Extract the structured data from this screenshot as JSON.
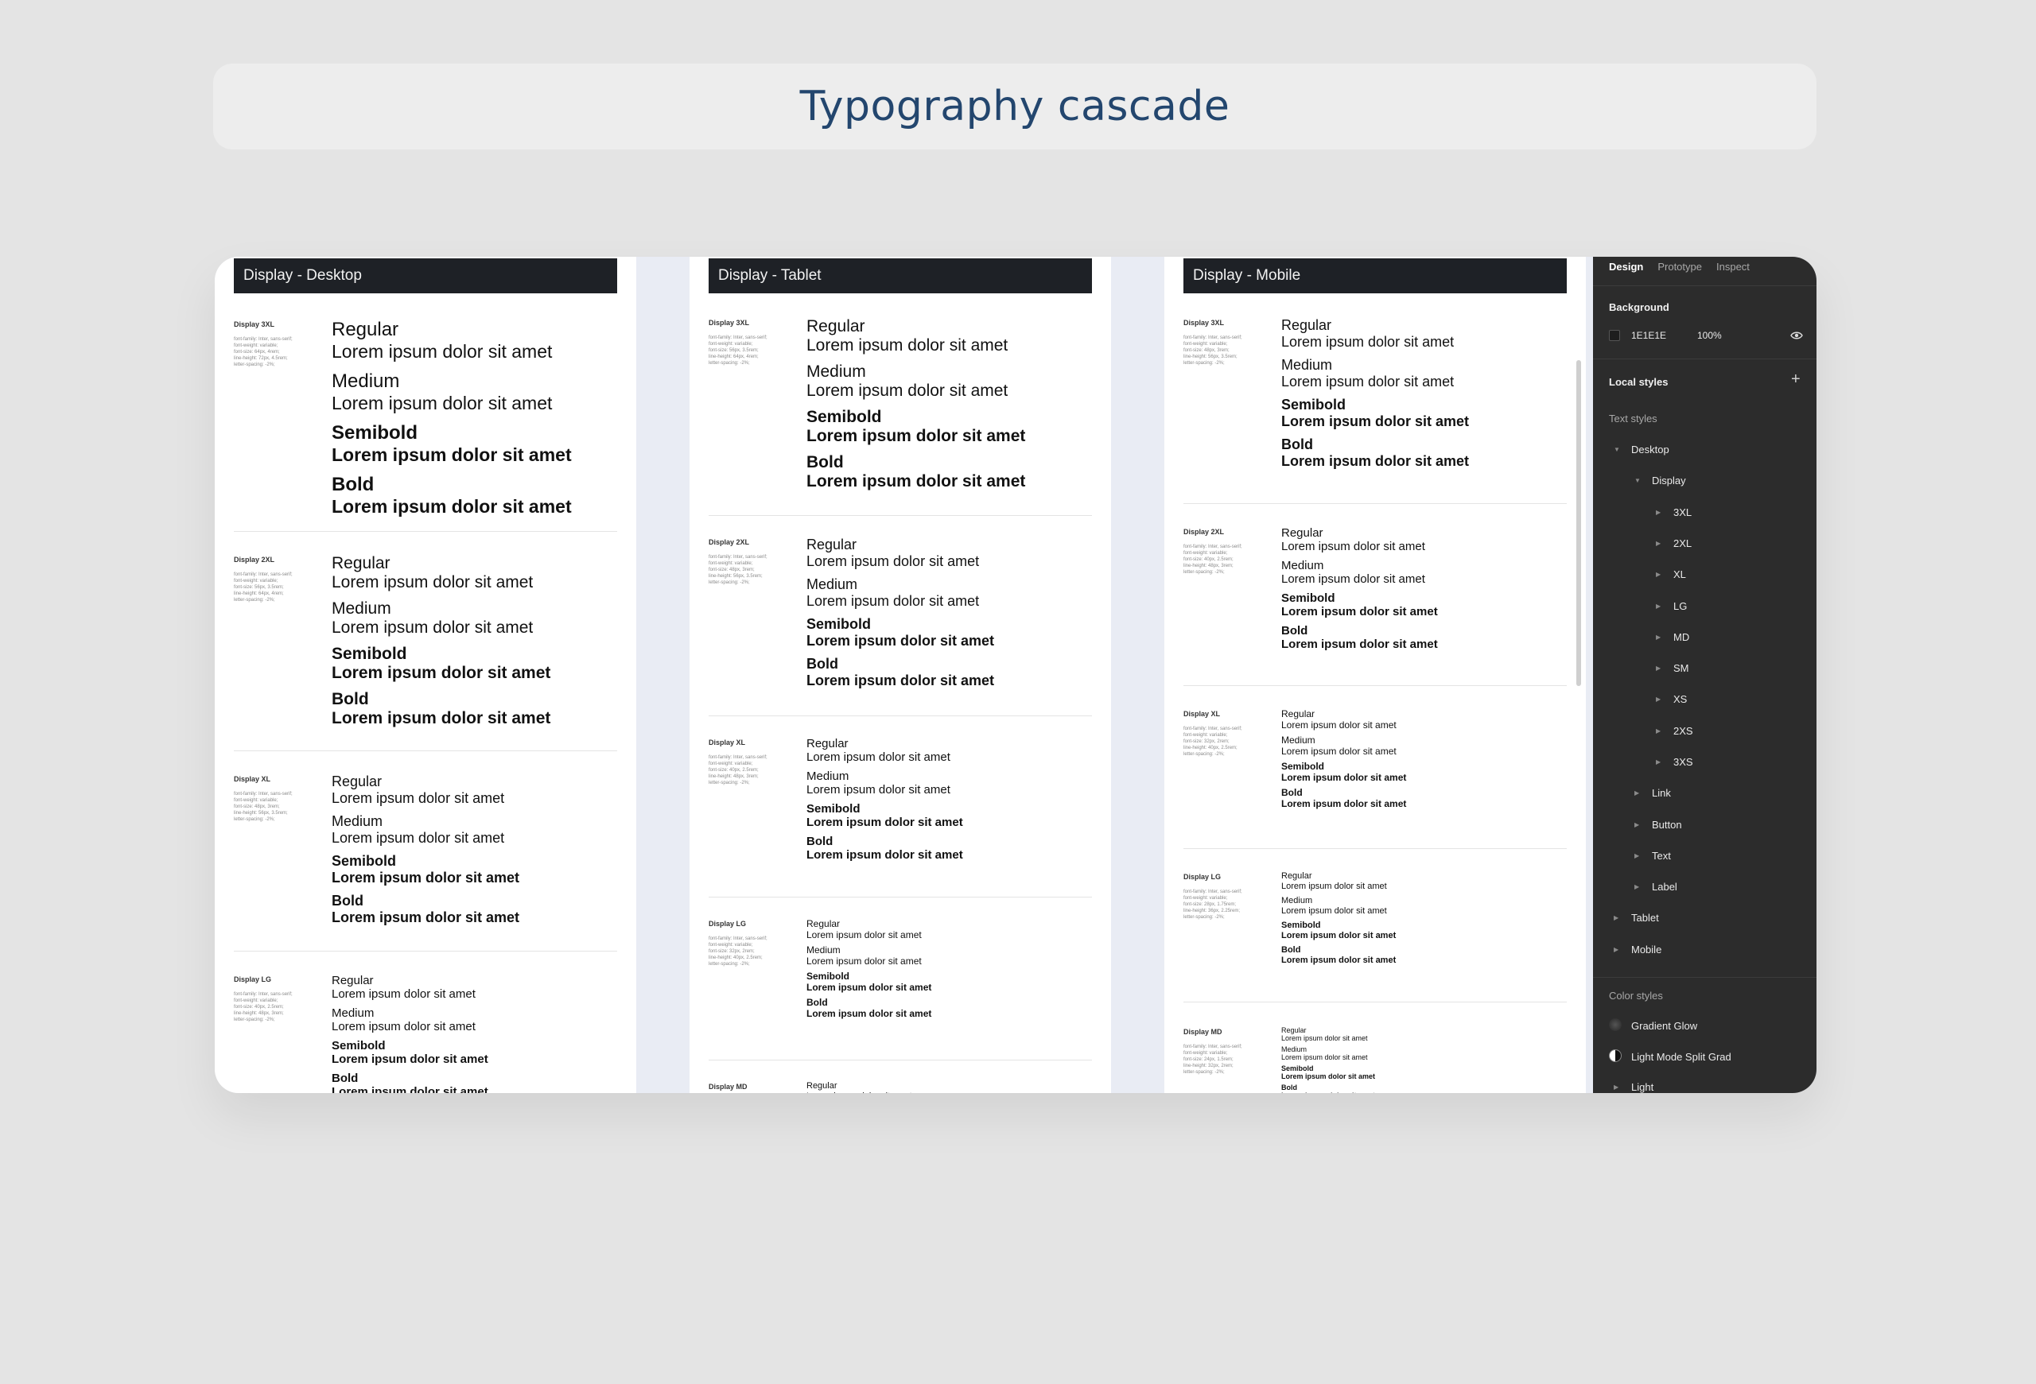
{
  "page": {
    "title": "Typography cascade"
  },
  "frames": [
    {
      "header": "Display - Desktop",
      "sections": [
        {
          "name": "Display 3XL",
          "meta": [
            "font-family: Inter, sans-serif;",
            "font-weight: variable;",
            "font-size: 64px, 4rem;",
            "line-height: 72px, 4.5rem;",
            "letter-spacing: -2%;"
          ]
        },
        {
          "name": "Display 2XL",
          "meta": [
            "font-family: Inter, sans-serif;",
            "font-weight: variable;",
            "font-size: 56px, 3.5rem;",
            "line-height: 64px, 4rem;",
            "letter-spacing: -2%;"
          ]
        },
        {
          "name": "Display XL",
          "meta": [
            "font-family: Inter, sans-serif;",
            "font-weight: variable;",
            "font-size: 48px, 3rem;",
            "line-height: 56px, 3.5rem;",
            "letter-spacing: -2%;"
          ]
        },
        {
          "name": "Display LG",
          "meta": [
            "font-family: Inter, sans-serif;",
            "font-weight: variable;",
            "font-size: 40px, 2.5rem;",
            "line-height: 48px, 3rem;",
            "letter-spacing: -2%;"
          ]
        }
      ]
    },
    {
      "header": "Display - Tablet",
      "sections": [
        {
          "name": "Display 3XL",
          "meta": [
            "font-family: Inter, sans-serif;",
            "font-weight: variable;",
            "font-size: 56px, 3.5rem;",
            "line-height: 64px, 4rem;",
            "letter-spacing: -2%;"
          ]
        },
        {
          "name": "Display 2XL",
          "meta": [
            "font-family: Inter, sans-serif;",
            "font-weight: variable;",
            "font-size: 48px, 3rem;",
            "line-height: 56px, 3.5rem;",
            "letter-spacing: -2%;"
          ]
        },
        {
          "name": "Display XL",
          "meta": [
            "font-family: Inter, sans-serif;",
            "font-weight: variable;",
            "font-size: 40px, 2.5rem;",
            "line-height: 48px, 3rem;",
            "letter-spacing: -2%;"
          ]
        },
        {
          "name": "Display LG",
          "meta": [
            "font-family: Inter, sans-serif;",
            "font-weight: variable;",
            "font-size: 32px, 2rem;",
            "line-height: 40px, 2.5rem;",
            "letter-spacing: -2%;"
          ]
        },
        {
          "name": "Display MD",
          "meta": []
        }
      ]
    },
    {
      "header": "Display - Mobile",
      "sections": [
        {
          "name": "Display 3XL",
          "meta": [
            "font-family: Inter, sans-serif;",
            "font-weight: variable;",
            "font-size: 48px, 3rem;",
            "line-height: 56px, 3.5rem;",
            "letter-spacing: -2%;"
          ]
        },
        {
          "name": "Display 2XL",
          "meta": [
            "font-family: Inter, sans-serif;",
            "font-weight: variable;",
            "font-size: 40px, 2.5rem;",
            "line-height: 48px, 3rem;",
            "letter-spacing: -2%;"
          ]
        },
        {
          "name": "Display XL",
          "meta": [
            "font-family: Inter, sans-serif;",
            "font-weight: variable;",
            "font-size: 32px, 2rem;",
            "line-height: 40px, 2.5rem;",
            "letter-spacing: -2%;"
          ]
        },
        {
          "name": "Display LG",
          "meta": [
            "font-family: Inter, sans-serif;",
            "font-weight: variable;",
            "font-size: 28px, 1.75rem;",
            "line-height: 36px, 2.25rem;",
            "letter-spacing: -2%;"
          ]
        },
        {
          "name": "Display MD",
          "meta": [
            "font-family: Inter, sans-serif;",
            "font-weight: variable;",
            "font-size: 24px, 1.5rem;",
            "line-height: 32px, 2rem;",
            "letter-spacing: -2%;"
          ]
        }
      ]
    }
  ],
  "weights": [
    "Regular",
    "Medium",
    "Semibold",
    "Bold"
  ],
  "sample_text": "Lorem ipsum dolor sit amet",
  "panel": {
    "tabs": [
      "Design",
      "Prototype",
      "Inspect"
    ],
    "background_label": "Background",
    "background_hex": "1E1E1E",
    "background_opacity": "100%",
    "local_styles": "Local styles",
    "text_styles": "Text styles",
    "tree": {
      "desktop": "Desktop",
      "display": "Display",
      "sizes": [
        "3XL",
        "2XL",
        "XL",
        "LG",
        "MD",
        "SM",
        "XS",
        "2XS",
        "3XS"
      ],
      "groups": [
        "Link",
        "Button",
        "Text",
        "Label"
      ],
      "tablet": "Tablet",
      "mobile": "Mobile"
    },
    "color_styles": "Color styles",
    "colors": [
      "Gradient Glow",
      "Light Mode Split Grad",
      "Light"
    ]
  },
  "colors": {
    "title": "#23466e",
    "header_bg": "#1e2126",
    "panel_bg": "#2c2c2c",
    "page_bg": "#e4e4e4"
  }
}
